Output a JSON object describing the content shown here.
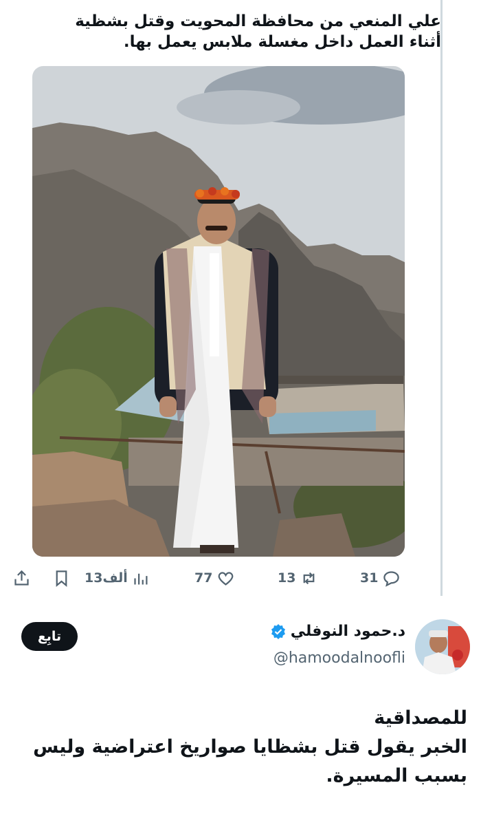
{
  "tweet": {
    "text_lines": [
      "علي المنعي من محافظة المحويت وقتل بشظية",
      "أثناء العمل داخل مغسلة ملابس يعمل بها."
    ],
    "media_alt": "رجل يرتدي ثوباً أبيض وإكليل زهور أمام جبال",
    "stats": {
      "replies": "31",
      "retweets": "13",
      "likes": "77",
      "views": "13ألف"
    }
  },
  "reply": {
    "display_name": "د.حمود النوفلي",
    "verified": true,
    "handle": "@hamoodalnoofli",
    "follow_label": "تابِع",
    "text_lines": [
      "للمصداقية",
      "الخبر يقول قتل بشظايا صواريخ اعتراضية وليس",
      "بسبب المسيرة."
    ]
  },
  "colors": {
    "text": "#0f1419",
    "muted": "#536471",
    "verified": "#1d9bf0",
    "divider": "#cfd9de"
  },
  "icons": [
    "share-icon",
    "bookmark-icon",
    "views-icon",
    "like-icon",
    "retweet-icon",
    "reply-icon",
    "verified-badge-icon"
  ]
}
